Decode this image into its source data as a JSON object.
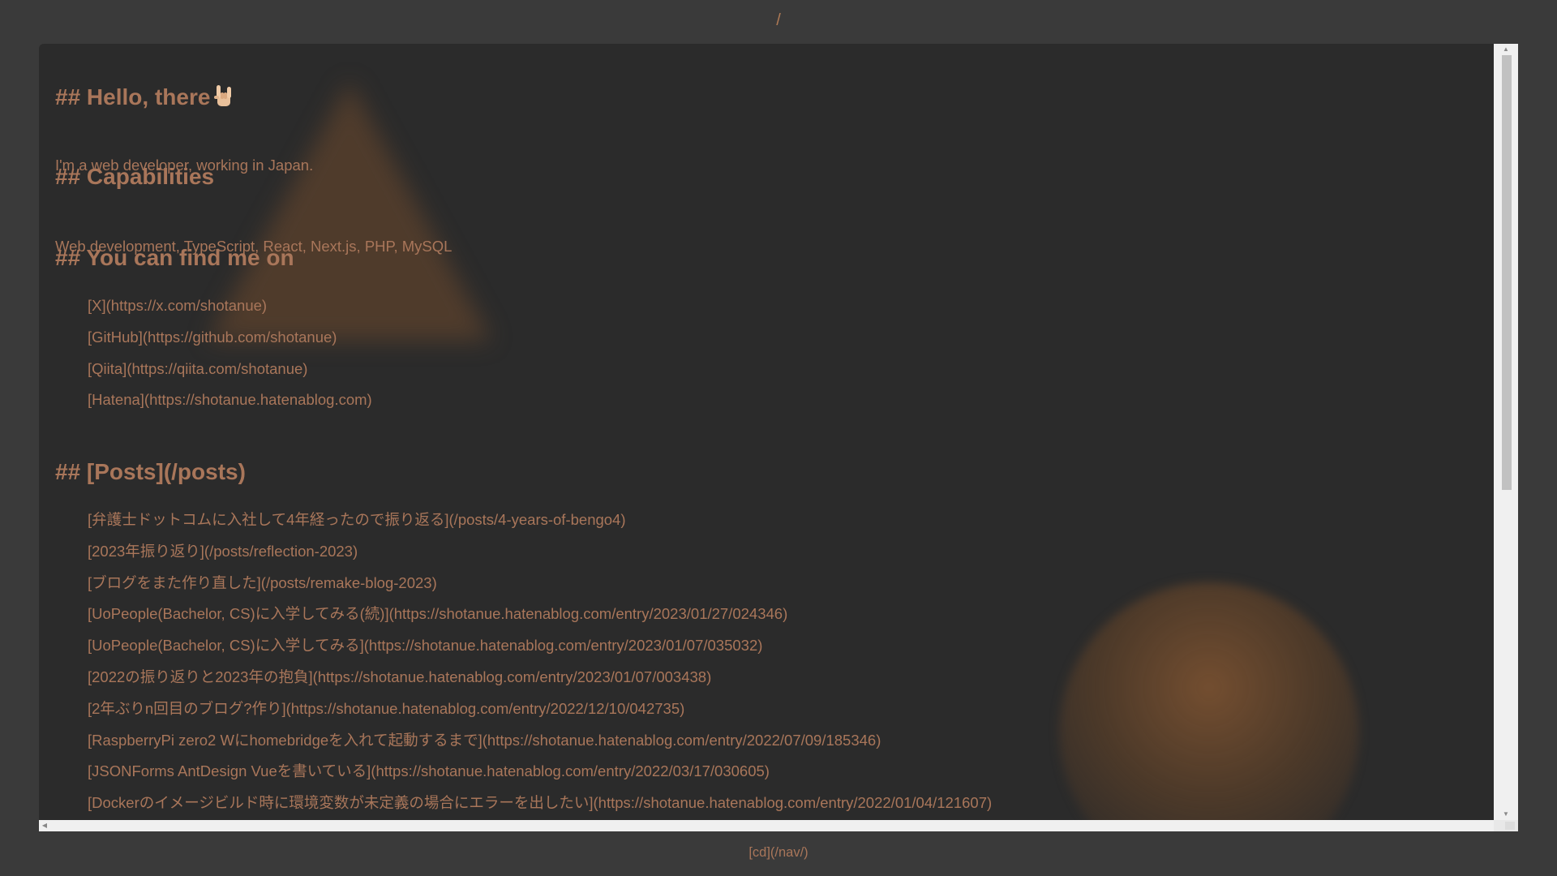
{
  "page": {
    "path_title": "/",
    "footer_link": "[cd](/nav/)"
  },
  "sections": {
    "hello": {
      "heading": "## Hello, there",
      "emoji": "sign-of-the-horns-icon",
      "text": "I'm a web developer, working in Japan."
    },
    "capabilities": {
      "heading": "## Capabilities",
      "text": "Web development, TypeScript, React, Next.js, PHP, MySQL"
    },
    "find_me": {
      "heading": "## You can find me on",
      "links": [
        "[X](https://x.com/shotanue)",
        "[GitHub](https://github.com/shotanue)",
        "[Qiita](https://qiita.com/shotanue)",
        "[Hatena](https://shotanue.hatenablog.com)"
      ]
    },
    "posts": {
      "heading": "## [Posts](/posts)",
      "links": [
        "[弁護士ドットコムに入社して4年経ったので振り返る](/posts/4-years-of-bengo4)",
        "[2023年振り返り](/posts/reflection-2023)",
        "[ブログをまた作り直した](/posts/remake-blog-2023)",
        "[UoPeople(Bachelor, CS)に入学してみる(続)](https://shotanue.hatenablog.com/entry/2023/01/27/024346)",
        "[UoPeople(Bachelor, CS)に入学してみる](https://shotanue.hatenablog.com/entry/2023/01/07/035032)",
        "[2022の振り返りと2023年の抱負](https://shotanue.hatenablog.com/entry/2023/01/07/003438)",
        "[2年ぶりn回目のブログ?作り](https://shotanue.hatenablog.com/entry/2022/12/10/042735)",
        "[RaspberryPi zero2 Wにhomebridgeを入れて起動するまで](https://shotanue.hatenablog.com/entry/2022/07/09/185346)",
        "[JSONForms AntDesign Vueを書いている](https://shotanue.hatenablog.com/entry/2022/03/17/030605)",
        "[Dockerのイメージビルド時に環境変数が未定義の場合にエラーを出したい](https://shotanue.hatenablog.com/entry/2022/01/04/121607)"
      ]
    }
  },
  "colors": {
    "background": "#3a3a3a",
    "panel": "#2b2b2b",
    "accent_text": "#a9765a"
  }
}
